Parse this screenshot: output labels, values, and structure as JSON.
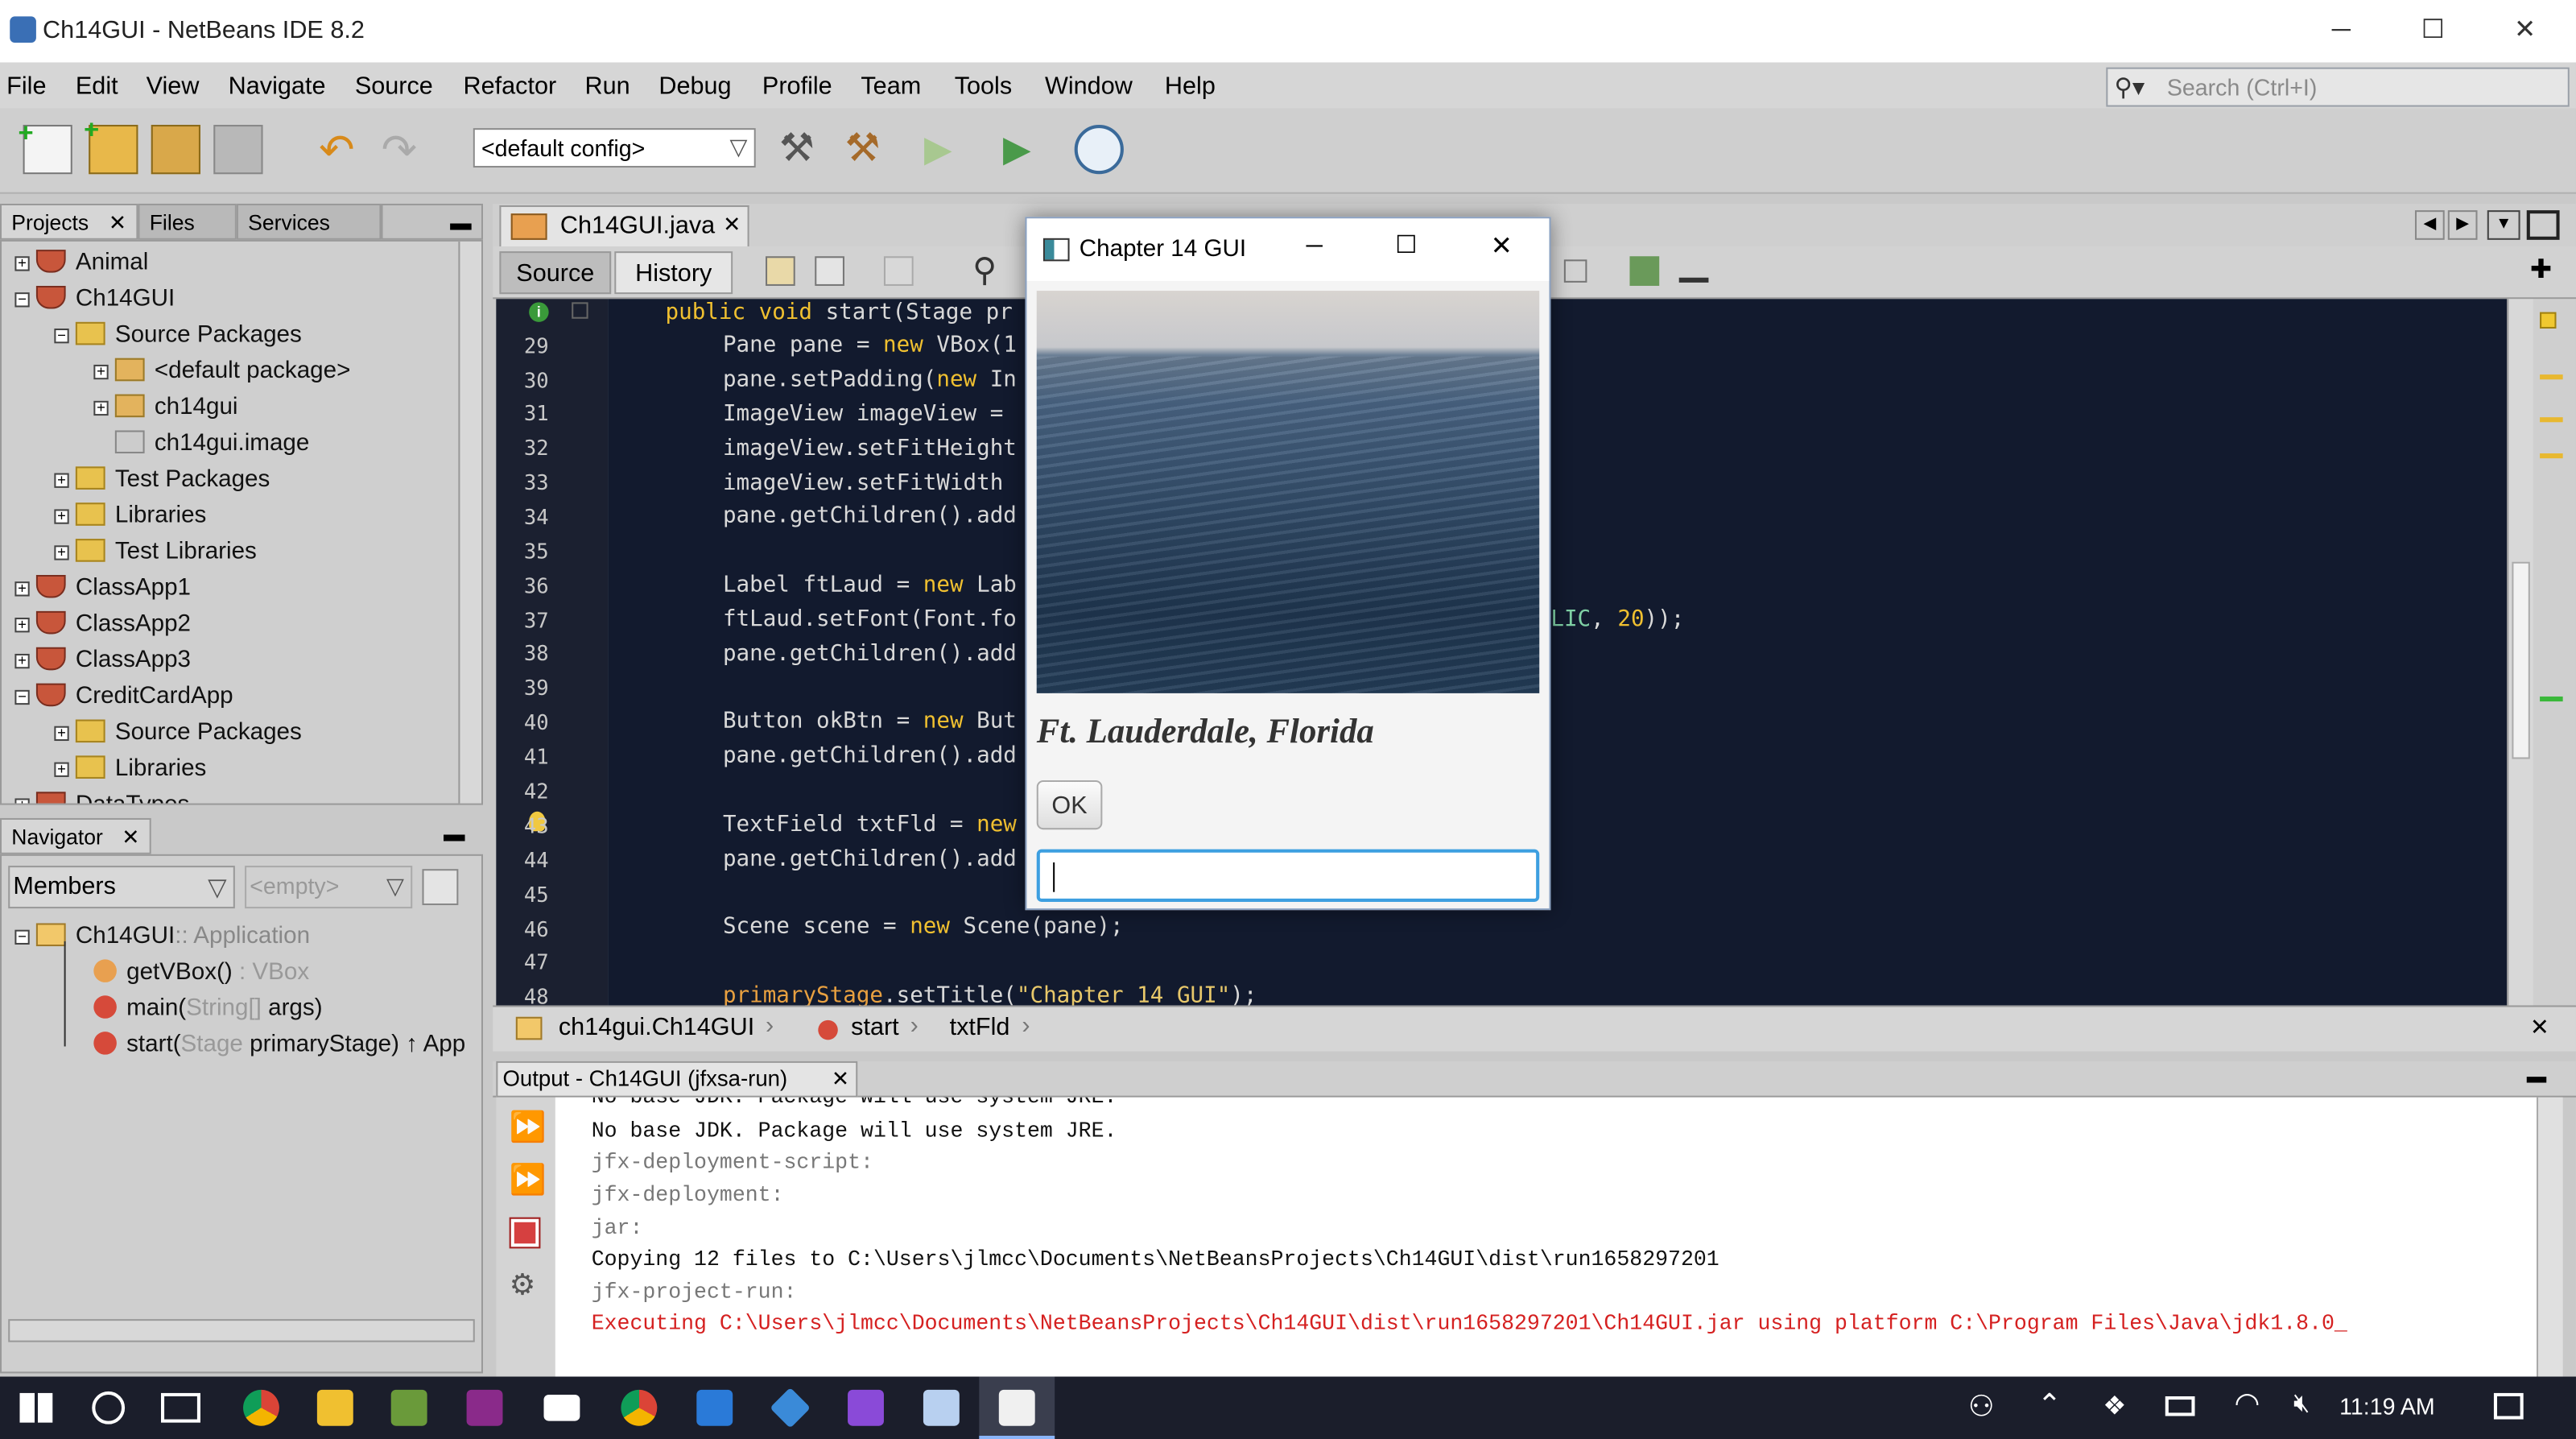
{
  "window": {
    "title": "Ch14GUI - NetBeans IDE 8.2",
    "minimize": "─",
    "maximize": "☐",
    "close": "✕"
  },
  "menu": [
    "File",
    "Edit",
    "View",
    "Navigate",
    "Source",
    "Refactor",
    "Run",
    "Debug",
    "Profile",
    "Team",
    "Tools",
    "Window",
    "Help"
  ],
  "search": {
    "placeholder": "Search (Ctrl+I)"
  },
  "toolbar": {
    "config": "<default config>"
  },
  "left_tabs": [
    "Projects",
    "Files",
    "Services"
  ],
  "project_tree": [
    {
      "label": "Animal",
      "icon": "project-icon"
    },
    {
      "label": "Ch14GUI",
      "icon": "project-icon"
    },
    {
      "label": "Source Packages",
      "icon": "folder-icon"
    },
    {
      "label": "<default package>",
      "icon": "package-icon"
    },
    {
      "label": "ch14gui",
      "icon": "package-icon"
    },
    {
      "label": "ch14gui.image",
      "icon": "package-icon"
    },
    {
      "label": "Test Packages",
      "icon": "folder-icon"
    },
    {
      "label": "Libraries",
      "icon": "folder-icon"
    },
    {
      "label": "Test Libraries",
      "icon": "folder-icon"
    },
    {
      "label": "ClassApp1",
      "icon": "project-icon"
    },
    {
      "label": "ClassApp2",
      "icon": "project-icon"
    },
    {
      "label": "ClassApp3",
      "icon": "project-icon"
    },
    {
      "label": "CreditCardApp",
      "icon": "project-icon"
    },
    {
      "label": "Source Packages",
      "icon": "folder-icon"
    },
    {
      "label": "Libraries",
      "icon": "folder-icon"
    },
    {
      "label": "DataTypes",
      "icon": "project-icon"
    }
  ],
  "navigator": {
    "tab": "Navigator",
    "filter": "Members",
    "empty": "<empty>",
    "root": "Ch14GUI",
    "root_suffix": ":: Application",
    "members": [
      {
        "name": "getVBox()",
        "type": " : VBox"
      },
      {
        "name": "main(",
        "type": "String[]",
        "rest": " args)"
      },
      {
        "name": "start(",
        "type": "Stage",
        "rest": " primaryStage) ↑ App"
      }
    ]
  },
  "editor": {
    "file_tab": "Ch14GUI.java",
    "source_tab": "Source",
    "history_tab": "History",
    "line_numbers": [
      "29",
      "30",
      "31",
      "32",
      "33",
      "34",
      "35",
      "36",
      "37",
      "38",
      "39",
      "40",
      "41",
      "42",
      "43",
      "44",
      "45",
      "46",
      "47",
      "48"
    ]
  },
  "breadcrumbs": [
    "ch14gui.Ch14GUI",
    "start",
    "txtFld"
  ],
  "output": {
    "tab": "Output - Ch14GUI (jfxsa-run)",
    "lines": [
      "No base JDK. Package will use system JRE.",
      "No base JDK. Package will use system JRE.",
      "jfx-deployment-script:",
      "jfx-deployment:",
      "jar:",
      "Copying 12 files to C:\\Users\\jlmcc\\Documents\\NetBeansProjects\\Ch14GUI\\dist\\run1658297201",
      "jfx-project-run:",
      "Executing C:\\Users\\jlmcc\\Documents\\NetBeansProjects\\Ch14GUI\\dist\\run1658297201\\Ch14GUI.jar using platform C:\\Program Files\\Java\\jdk1.8.0_"
    ]
  },
  "popup": {
    "title": "Chapter 14 GUI",
    "caption": "Ft. Lauderdale, Florida",
    "ok": "OK",
    "minimize": "─",
    "maximize": "☐",
    "close": "✕"
  },
  "taskbar": {
    "time": "11:19 AM"
  }
}
